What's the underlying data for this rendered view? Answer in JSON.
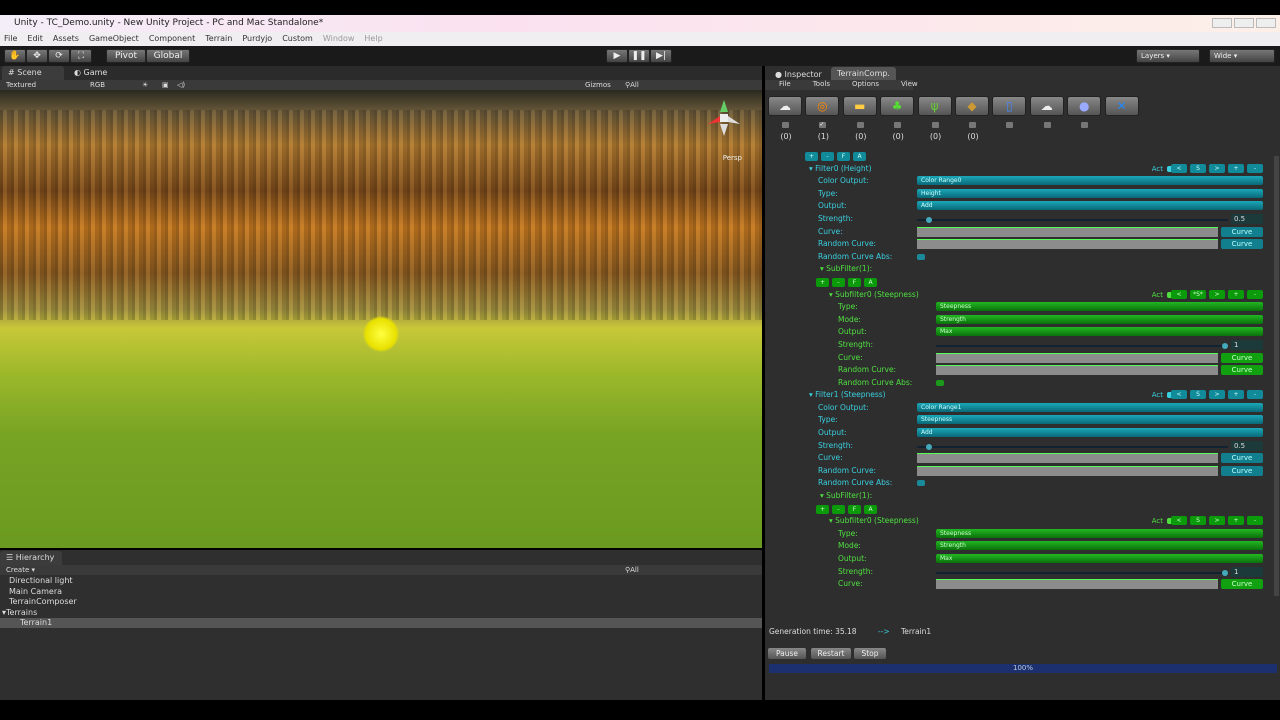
{
  "window": {
    "title": "Unity - TC_Demo.unity - New Unity Project - PC and Mac Standalone*"
  },
  "menu": [
    "File",
    "Edit",
    "Assets",
    "GameObject",
    "Component",
    "Terrain",
    "Purdyjo",
    "Custom",
    "Window",
    "Help"
  ],
  "toolbar": {
    "pivot": "Pivot",
    "global": "Global",
    "layers": "Layers",
    "layout": "Wide"
  },
  "scene": {
    "tab_scene": "Scene",
    "tab_game": "Game",
    "render_mode": "Textured",
    "channel": "RGB",
    "gizmos": "Gizmos",
    "search": "All",
    "persp": "Persp"
  },
  "hierarchy": {
    "title": "Hierarchy",
    "create": "Create",
    "search": "All",
    "items": [
      "Directional light",
      "Main Camera",
      "TerrainComposer",
      "Terrains",
      "Terrain1"
    ]
  },
  "inspector": {
    "tab_inspector": "Inspector",
    "tab_tc": "TerrainComp.",
    "menu": [
      "File",
      "Tools",
      "Options",
      "View"
    ],
    "tools": [
      "clouds-icon",
      "color-wheel-icon",
      "landscape-icon",
      "tree-icon",
      "grass-icon",
      "objects-icon",
      "save-icon",
      "cloud-icon",
      "sphere-icon",
      "settings-icon"
    ],
    "tool_checked": [
      false,
      true,
      false,
      false,
      false,
      false,
      false,
      false,
      false
    ],
    "counts": [
      "(0)",
      "(1)",
      "(0)",
      "(0)",
      "(0)",
      "(0)"
    ],
    "rows": [
      {
        "k": "btns",
        "c": "teal",
        "i": 0,
        "b": [
          "+",
          "-",
          "F",
          "A"
        ]
      },
      {
        "k": "head",
        "c": "teal",
        "i": 0,
        "t": "▾ Filter0 (Height)",
        "act": "Act",
        "b": [
          "<",
          "S",
          ">",
          "+",
          "-"
        ]
      },
      {
        "k": "field",
        "c": "teal",
        "i": 1,
        "t": "Color Output:",
        "v": "Color Range0"
      },
      {
        "k": "field",
        "c": "teal",
        "i": 1,
        "t": "Type:",
        "v": "Height"
      },
      {
        "k": "field",
        "c": "teal",
        "i": 1,
        "t": "Output:",
        "v": "Add"
      },
      {
        "k": "slider",
        "c": "teal",
        "i": 1,
        "t": "Strength:",
        "v": "0.5",
        "f": 0.05
      },
      {
        "k": "curve",
        "c": "teal",
        "i": 1,
        "t": "Curve:",
        "v": "Curve"
      },
      {
        "k": "curve",
        "c": "teal",
        "i": 1,
        "t": "Random Curve:",
        "v": "Curve"
      },
      {
        "k": "tog",
        "c": "teal",
        "i": 1,
        "t": "Random Curve Abs:"
      },
      {
        "k": "label",
        "c": "green",
        "i": 2,
        "t": "▾ SubFilter(1):"
      },
      {
        "k": "btns",
        "c": "green",
        "i": 2,
        "b": [
          "+",
          "-",
          "F",
          "A"
        ]
      },
      {
        "k": "head",
        "c": "green",
        "i": 3,
        "t": "▾ Subfilter0 (Steepness)",
        "act": "Act",
        "b": [
          "<",
          "*S*",
          ">",
          "+",
          "-"
        ]
      },
      {
        "k": "field",
        "c": "green",
        "i": 4,
        "t": "Type:",
        "v": "Steepness"
      },
      {
        "k": "field",
        "c": "green",
        "i": 4,
        "t": "Mode:",
        "v": "Strength"
      },
      {
        "k": "field",
        "c": "green",
        "i": 4,
        "t": "Output:",
        "v": "Max"
      },
      {
        "k": "slider",
        "c": "green",
        "i": 4,
        "t": "Strength:",
        "v": "1",
        "f": 1
      },
      {
        "k": "curve",
        "c": "green",
        "i": 4,
        "t": "Curve:",
        "v": "Curve"
      },
      {
        "k": "curve",
        "c": "green",
        "i": 4,
        "t": "Random Curve:",
        "v": "Curve"
      },
      {
        "k": "tog",
        "c": "green",
        "i": 4,
        "t": "Random Curve Abs:"
      },
      {
        "k": "head",
        "c": "teal",
        "i": 0,
        "t": "▾ Filter1 (Steepness)",
        "act": "Act",
        "b": [
          "<",
          "S",
          ">",
          "+",
          "-"
        ]
      },
      {
        "k": "field",
        "c": "teal",
        "i": 1,
        "t": "Color Output:",
        "v": "Color Range1"
      },
      {
        "k": "field",
        "c": "teal",
        "i": 1,
        "t": "Type:",
        "v": "Steepness"
      },
      {
        "k": "field",
        "c": "teal",
        "i": 1,
        "t": "Output:",
        "v": "Add"
      },
      {
        "k": "slider",
        "c": "teal",
        "i": 1,
        "t": "Strength:",
        "v": "0.5",
        "f": 0.05
      },
      {
        "k": "curve",
        "c": "teal",
        "i": 1,
        "t": "Curve:",
        "v": "Curve"
      },
      {
        "k": "curve",
        "c": "teal",
        "i": 1,
        "t": "Random Curve:",
        "v": "Curve"
      },
      {
        "k": "tog",
        "c": "teal",
        "i": 1,
        "t": "Random Curve Abs:"
      },
      {
        "k": "label",
        "c": "green",
        "i": 2,
        "t": "▾ SubFilter(1):"
      },
      {
        "k": "btns",
        "c": "green",
        "i": 2,
        "b": [
          "+",
          "-",
          "F",
          "A"
        ]
      },
      {
        "k": "head",
        "c": "green",
        "i": 3,
        "t": "▾ Subfilter0 (Steepness)",
        "act": "Act",
        "b": [
          "<",
          "S",
          ">",
          "+",
          "-"
        ]
      },
      {
        "k": "field",
        "c": "green",
        "i": 4,
        "t": "Type:",
        "v": "Steepness"
      },
      {
        "k": "field",
        "c": "green",
        "i": 4,
        "t": "Mode:",
        "v": "Strength"
      },
      {
        "k": "field",
        "c": "green",
        "i": 4,
        "t": "Output:",
        "v": "Max"
      },
      {
        "k": "slider",
        "c": "green",
        "i": 4,
        "t": "Strength:",
        "v": "1",
        "f": 1
      },
      {
        "k": "curve",
        "c": "green",
        "i": 4,
        "t": "Curve:",
        "v": "Curve"
      }
    ],
    "generation_label": "Generation time: 35.18",
    "arrow": "-->",
    "target": "Terrain1",
    "pause": "Pause",
    "restart": "Restart",
    "stop": "Stop",
    "progress_label": "100%",
    "progress": 1.0
  }
}
